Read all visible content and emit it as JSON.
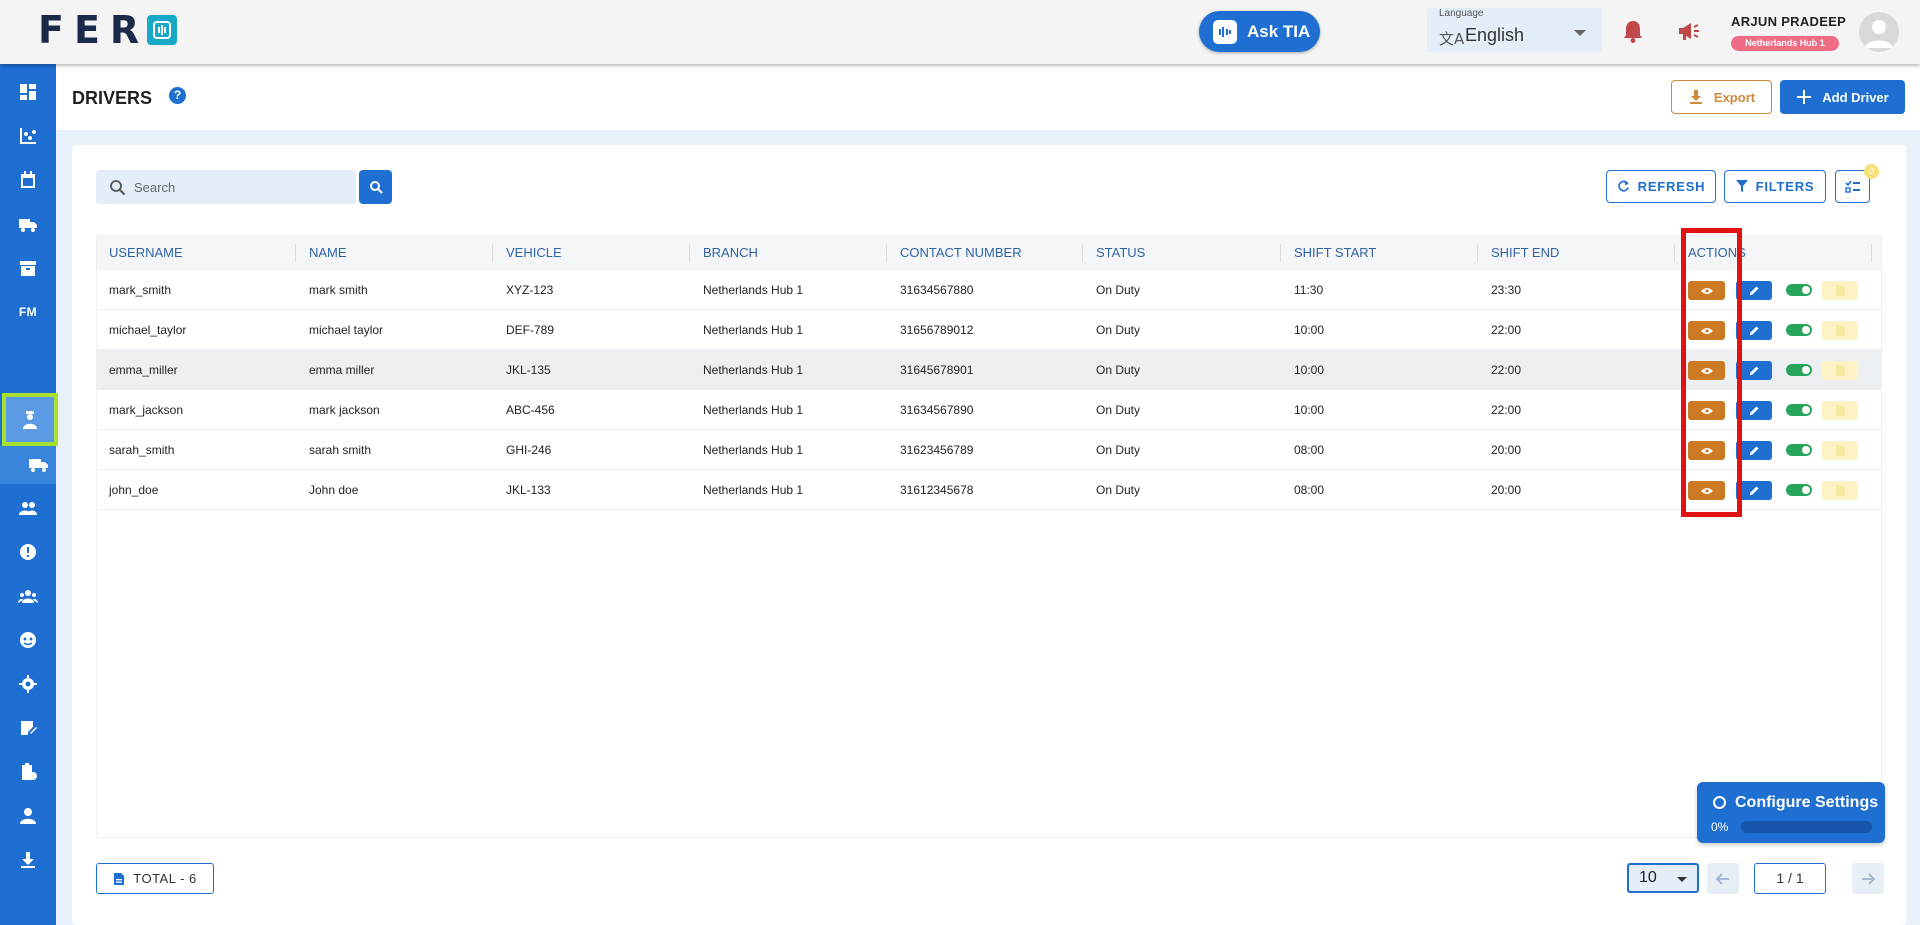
{
  "header": {
    "logo_text": "FER",
    "ask_tia": "Ask TIA",
    "language_label": "Language",
    "language_value": "English",
    "user_name": "ARJUN PRADEEP",
    "user_branch": "Netherlands Hub 1"
  },
  "sidebar": {
    "items": [
      "dashboard-icon",
      "analytics-icon",
      "calendar-icon",
      "truck-icon",
      "archive-icon",
      "fm-label",
      "driver-icon",
      "vehicle-icon",
      "users-icon",
      "info-icon",
      "team-icon",
      "support-icon",
      "settings-icon",
      "notes-icon",
      "clipboard-icon",
      "person-icon",
      "download-icon"
    ],
    "fm_label": "FM"
  },
  "page": {
    "title": "DRIVERS",
    "help": "?",
    "export_label": "Export",
    "add_label": "Add Driver"
  },
  "toolbar": {
    "search_placeholder": "Search",
    "refresh_label": "REFRESH",
    "filters_label": "FILTERS",
    "columns_badge": "0"
  },
  "table": {
    "columns": [
      "USERNAME",
      "NAME",
      "VEHICLE",
      "BRANCH",
      "CONTACT NUMBER",
      "STATUS",
      "SHIFT START",
      "SHIFT END",
      "ACTIONS"
    ],
    "rows": [
      [
        "mark_smith",
        "mark smith",
        "XYZ-123",
        "Netherlands Hub 1",
        "31634567880",
        "On Duty",
        "11:30",
        "23:30"
      ],
      [
        "michael_taylor",
        "michael taylor",
        "DEF-789",
        "Netherlands Hub 1",
        "31656789012",
        "On Duty",
        "10:00",
        "22:00"
      ],
      [
        "emma_miller",
        "emma miller",
        "JKL-135",
        "Netherlands Hub 1",
        "31645678901",
        "On Duty",
        "10:00",
        "22:00"
      ],
      [
        "mark_jackson",
        "mark jackson",
        "ABC-456",
        "Netherlands Hub 1",
        "31634567890",
        "On Duty",
        "10:00",
        "22:00"
      ],
      [
        "sarah_smith",
        "sarah smith",
        "GHI-246",
        "Netherlands Hub 1",
        "31623456789",
        "On Duty",
        "08:00",
        "20:00"
      ],
      [
        "john_doe",
        "John doe",
        "JKL-133",
        "Netherlands Hub 1",
        "31612345678",
        "On Duty",
        "08:00",
        "20:00"
      ]
    ],
    "highlighted_row": 2
  },
  "footer": {
    "total_label": "TOTAL  - 6",
    "page_size": "10",
    "page_indicator": "1 / 1"
  },
  "config": {
    "title": "Configure Settings",
    "percent": "0%",
    "progress": 0
  },
  "colors": {
    "primary": "#1e6fd1",
    "view": "#cc7a24",
    "toggle": "#27a55a",
    "doc": "#fdf3c4",
    "badge": "#f06b84",
    "highlight_box": "#e01212",
    "sidebar_active": "#a6e22e"
  }
}
